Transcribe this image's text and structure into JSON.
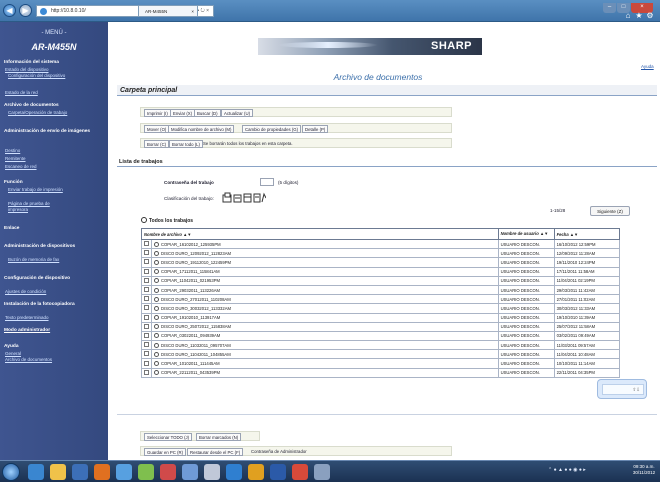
{
  "browser": {
    "address": "http://10.8.0.10/",
    "address_controls": "⌕ • ↻ ×",
    "tab_label": "AR-M455N",
    "tab_close": "×",
    "window_controls": [
      "–",
      "□",
      "×"
    ],
    "toolbar_icons": [
      "⌂",
      "★",
      "⚙"
    ]
  },
  "sidebar": {
    "menu_label": "- MENÚ -",
    "model": "AR-M455N",
    "sections": [
      {
        "title": "Información del sistema",
        "links": [
          "Estado del dispositivo",
          "Configuración del dispositivo",
          "Estado de la red"
        ]
      },
      {
        "title": "Archivo de documentos",
        "links": [
          "Carpeta/Operación de trabajo"
        ]
      },
      {
        "title": "Administración de envío de imágenes",
        "links": [
          "Destino",
          "Remitente",
          "Escaneo de red"
        ]
      },
      {
        "title": "Función",
        "links": [
          "Enviar trabajo de impresión",
          "Página de prueba de impresora"
        ]
      },
      {
        "title": "Enlace",
        "links": []
      },
      {
        "title": "Administración de dispositivos",
        "links": [
          "Buzón de memoria de fax"
        ]
      },
      {
        "title": "Configuración de dispositivo",
        "links": [
          "Ajustes de condición"
        ]
      },
      {
        "title": "Instalación de la fotocopiadora",
        "links": [
          "Texto predeterminado"
        ]
      },
      {
        "title": "Modo administrador",
        "links": []
      },
      {
        "title": "Ayuda",
        "links": [
          "General",
          "Archivo de documentos"
        ]
      }
    ]
  },
  "header": {
    "brand": "SHARP",
    "help_link": "Ayuda",
    "title": "Archivo de documentos",
    "section": "Carpeta principal"
  },
  "toolbar1": [
    "Imprimir (I)",
    "Enviar (X)",
    "Buscar (D)",
    "Actualizar (U)"
  ],
  "toolbar2": [
    "Mover (O)",
    "Modifica nombre de archivo (M)",
    "Cambio de propiedades (G)",
    "Detalle (P)"
  ],
  "toolbar3": {
    "buttons": [
      "Borrar (C)",
      "Borrar todo (L)"
    ],
    "note": "Se borrarán todos los trabajos en esta carpeta."
  },
  "list": {
    "title": "Lista de trabajos",
    "password_label": "Contraseña del trabajo",
    "password_hint": "(5 dígitos)",
    "class_label": "Clasificación del trabajo:",
    "all_jobs": "Todos los trabajos",
    "pager": "1-15/28",
    "next_button": "Siguiente (Z)",
    "columns": [
      "Nombre de archivo",
      "Nombre de usuario",
      "Fecha"
    ],
    "rows": [
      {
        "name": "COPIAR_16102012_125935PM",
        "user": "USUARIO DESCON.",
        "date": "16/10/2012 12:59PM"
      },
      {
        "name": "DISCO DURO_12092012_112823AM",
        "user": "USUARIO DESCON.",
        "date": "12/09/2012 11:28AM"
      },
      {
        "name": "DISCO DURO_19112010_122459PM",
        "user": "USUARIO DESCON.",
        "date": "19/11/2010 12:24PM"
      },
      {
        "name": "COPIAR_17112011_115841AM",
        "user": "USUARIO DESCON.",
        "date": "17/11/2011 11:58AM"
      },
      {
        "name": "COPIAR_11042011_021953PM",
        "user": "USUARIO DESCON.",
        "date": "11/04/2011 02:19PM"
      },
      {
        "name": "COPIAR_29032011_113226AM",
        "user": "USUARIO DESCON.",
        "date": "29/03/2011 11:42AM"
      },
      {
        "name": "DISCO DURO_27012011_110208AM",
        "user": "USUARIO DESCON.",
        "date": "27/01/2011 11:02AM"
      },
      {
        "name": "DISCO DURO_30032012_113332AM",
        "user": "USUARIO DESCON.",
        "date": "30/03/2012 11:33AM"
      },
      {
        "name": "COPIAR_19102010_113917AM",
        "user": "USUARIO DESCON.",
        "date": "19/10/2010 11:39AM"
      },
      {
        "name": "DISCO DURO_25072012_115838AM",
        "user": "USUARIO DESCON.",
        "date": "25/07/2012 11:58AM"
      },
      {
        "name": "COPIAR_03022011_094939AM",
        "user": "USUARIO DESCON.",
        "date": "03/02/2011 09:49AM"
      },
      {
        "name": "DISCO DURO_11032011_095707AM",
        "user": "USUARIO DESCON.",
        "date": "11/03/2011 09:57AM"
      },
      {
        "name": "DISCO DURO_11042011_104855AM",
        "user": "USUARIO DESCON.",
        "date": "11/04/2011 10:48AM"
      },
      {
        "name": "COPIAR_10102011_111445AM",
        "user": "USUARIO DESCON.",
        "date": "10/10/2011 11:14AM"
      },
      {
        "name": "COPIAR_22112011_043539PM",
        "user": "USUARIO DESCON.",
        "date": "22/11/2011 04:35PM"
      }
    ]
  },
  "footer": {
    "row1": [
      "Seleccionar TODO (J)",
      "Borrar marcados (N)"
    ],
    "row2": [
      "Guardar en PC (R)",
      "Restaurar desde el PC (F)"
    ],
    "admin_password": "Contraseña de Administrador"
  },
  "taskbar": {
    "clock": "09:30 a.m.",
    "date": "30/11/2012"
  }
}
